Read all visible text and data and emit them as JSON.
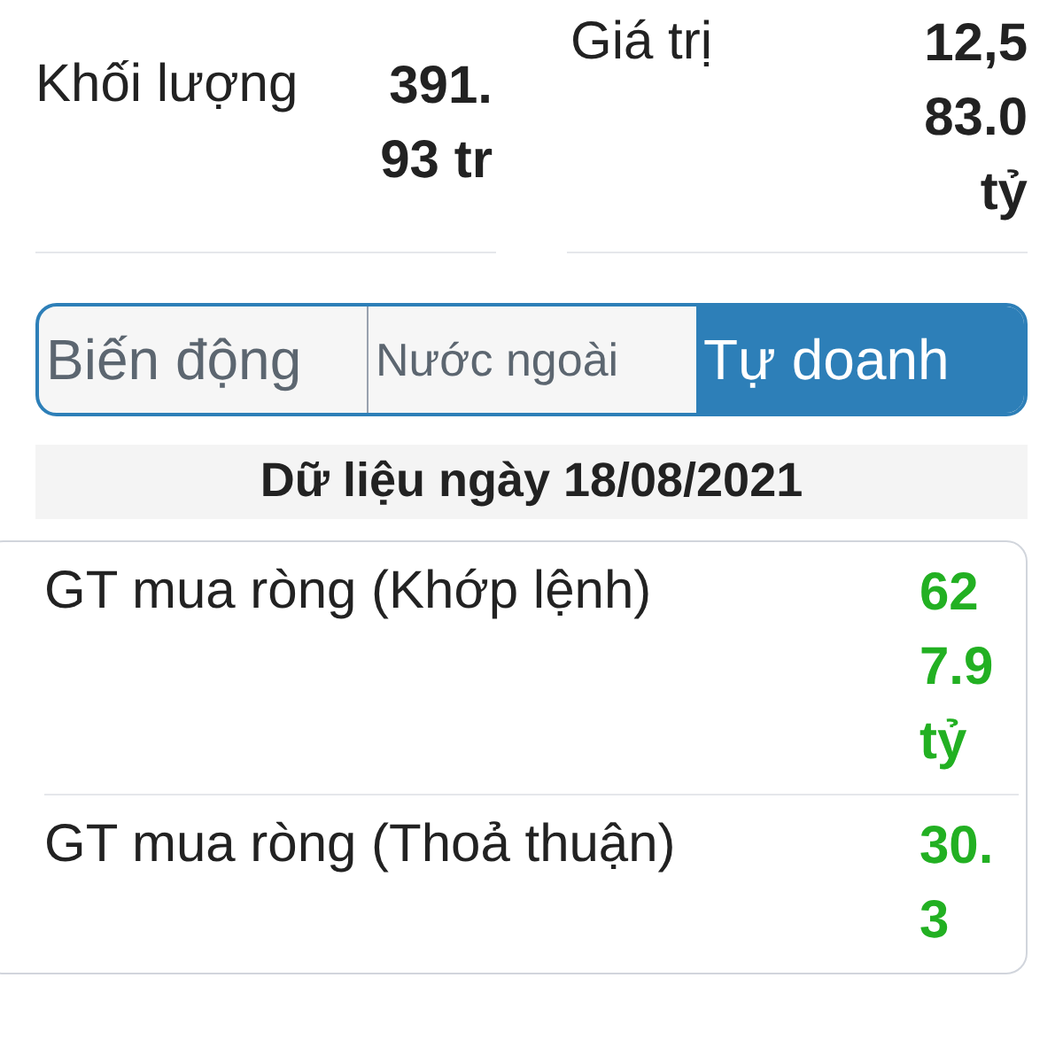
{
  "stats": [
    {
      "label": "Khối lượng",
      "value": "391.93 tr"
    },
    {
      "label": "Giá trị",
      "value": "12,583.0 tỷ"
    }
  ],
  "tabs": [
    {
      "label": "Biến động",
      "selected": false
    },
    {
      "label": "Nước ngoài",
      "selected": false
    },
    {
      "label": "Tự doanh",
      "selected": true
    }
  ],
  "date_header": "Dữ liệu ngày 18/08/2021",
  "rows": [
    {
      "label": "GT mua ròng (Khớp lệnh)",
      "value": "627.9 tỷ"
    },
    {
      "label": "GT mua ròng (Thoả thuận)",
      "value": "30.3"
    }
  ]
}
